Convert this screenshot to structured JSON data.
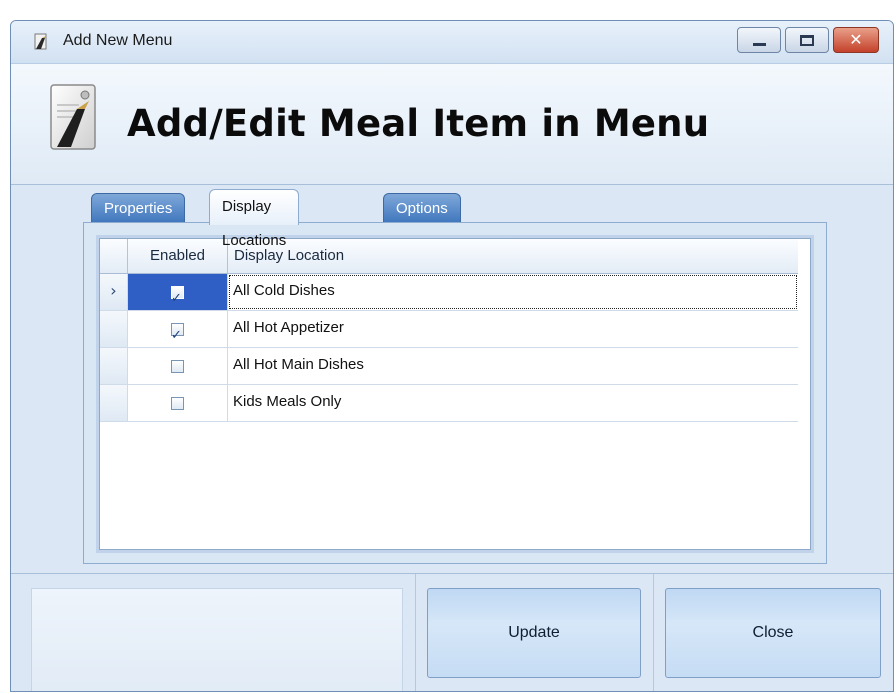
{
  "window": {
    "title": "Add New Menu",
    "controls": {
      "minimize_icon": "minimize-icon",
      "maximize_icon": "maximize-icon",
      "close_icon": "close-icon"
    }
  },
  "header": {
    "title": "Add/Edit Meal Item in Menu",
    "icon": "menu-document-icon"
  },
  "tabs": [
    {
      "label": "Properties",
      "active": false
    },
    {
      "label": "Display Locations",
      "active": true
    },
    {
      "label": "Options",
      "active": false
    }
  ],
  "grid": {
    "columns": [
      "Enabled",
      "Display Location"
    ],
    "row_indicator": "›",
    "rows": [
      {
        "enabled": true,
        "location": "All Cold Dishes",
        "selected": true
      },
      {
        "enabled": true,
        "location": "All Hot Appetizer",
        "selected": false
      },
      {
        "enabled": false,
        "location": "All Hot Main Dishes",
        "selected": false
      },
      {
        "enabled": false,
        "location": "Kids Meals Only",
        "selected": false
      }
    ]
  },
  "footer": {
    "update_label": "Update",
    "close_label": "Close"
  },
  "colors": {
    "selection": "#2f5fc4",
    "tab_inactive": "#3f76bd",
    "window_bg": "#dbe7f4"
  }
}
